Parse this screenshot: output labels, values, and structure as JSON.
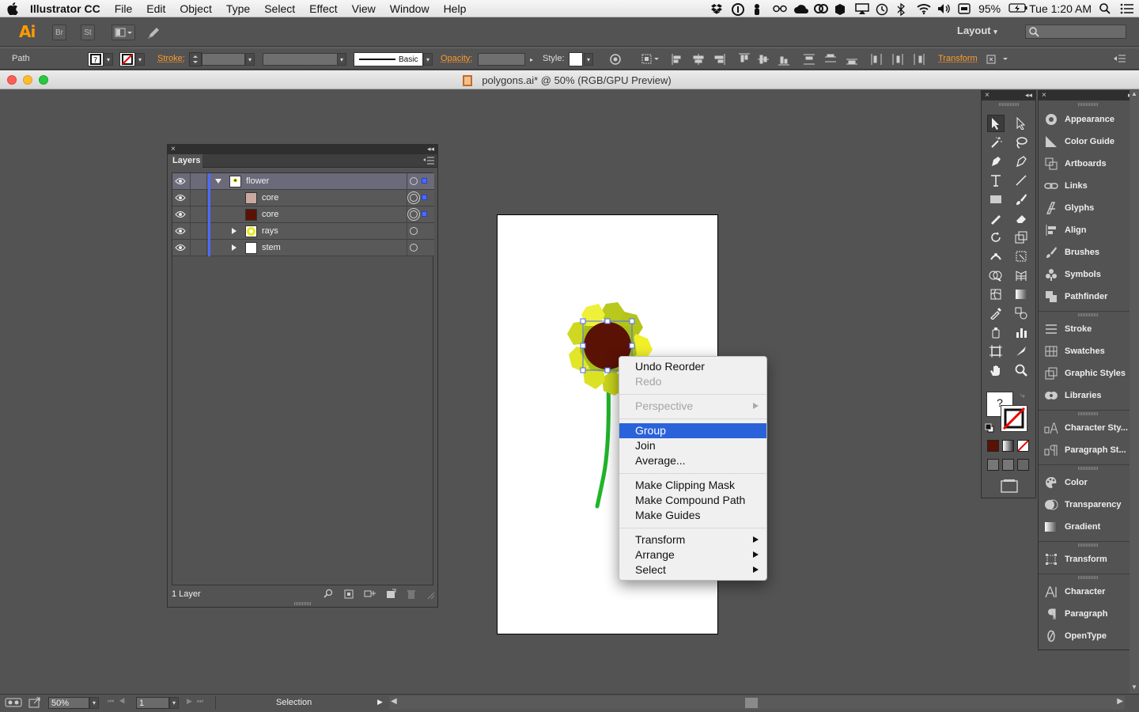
{
  "menubar": {
    "app_name": "Illustrator CC",
    "menus": [
      "File",
      "Edit",
      "Object",
      "Type",
      "Select",
      "Effect",
      "View",
      "Window",
      "Help"
    ],
    "battery": "95%",
    "clock": "Tue 1:20 AM"
  },
  "appbar": {
    "logo": "Ai",
    "bridge": "Br",
    "stock": "St",
    "workspace": "Layout"
  },
  "control": {
    "selection_type": "Path",
    "stroke_label": "Stroke:",
    "brush_label": "Basic",
    "opacity_label": "Opacity:",
    "style_label": "Style:",
    "transform_label": "Transform"
  },
  "window": {
    "title": "polygons.ai* @ 50% (RGB/GPU Preview)"
  },
  "layers_panel": {
    "tab": "Layers",
    "footer_count": "1 Layer",
    "rows": [
      {
        "name": "flower"
      },
      {
        "name": "core"
      },
      {
        "name": "core"
      },
      {
        "name": "rays"
      },
      {
        "name": "stem"
      }
    ]
  },
  "context_menu": {
    "items": [
      "Undo Reorder",
      "Redo",
      "Perspective",
      "Group",
      "Join",
      "Average...",
      "Make Clipping Mask",
      "Make Compound Path",
      "Make Guides",
      "Transform",
      "Arrange",
      "Select"
    ]
  },
  "dock": {
    "items": [
      "Appearance",
      "Color Guide",
      "Artboards",
      "Links",
      "Glyphs",
      "Align",
      "Brushes",
      "Symbols",
      "Pathfinder",
      "Stroke",
      "Swatches",
      "Graphic Styles",
      "Libraries",
      "Character Sty...",
      "Paragraph St...",
      "Color",
      "Transparency",
      "Gradient",
      "Transform",
      "Character",
      "Paragraph",
      "OpenType"
    ]
  },
  "tools": {
    "help_glyph": "?"
  },
  "statusbar": {
    "zoom": "50%",
    "artboard_number": "1",
    "status": "Selection"
  },
  "colors": {
    "accent": "#ff9a2b",
    "highlight": "#2a62d9",
    "layer_color": "#4b6bff",
    "core_fill": "#5a1205",
    "stem": "#1fb52a"
  }
}
